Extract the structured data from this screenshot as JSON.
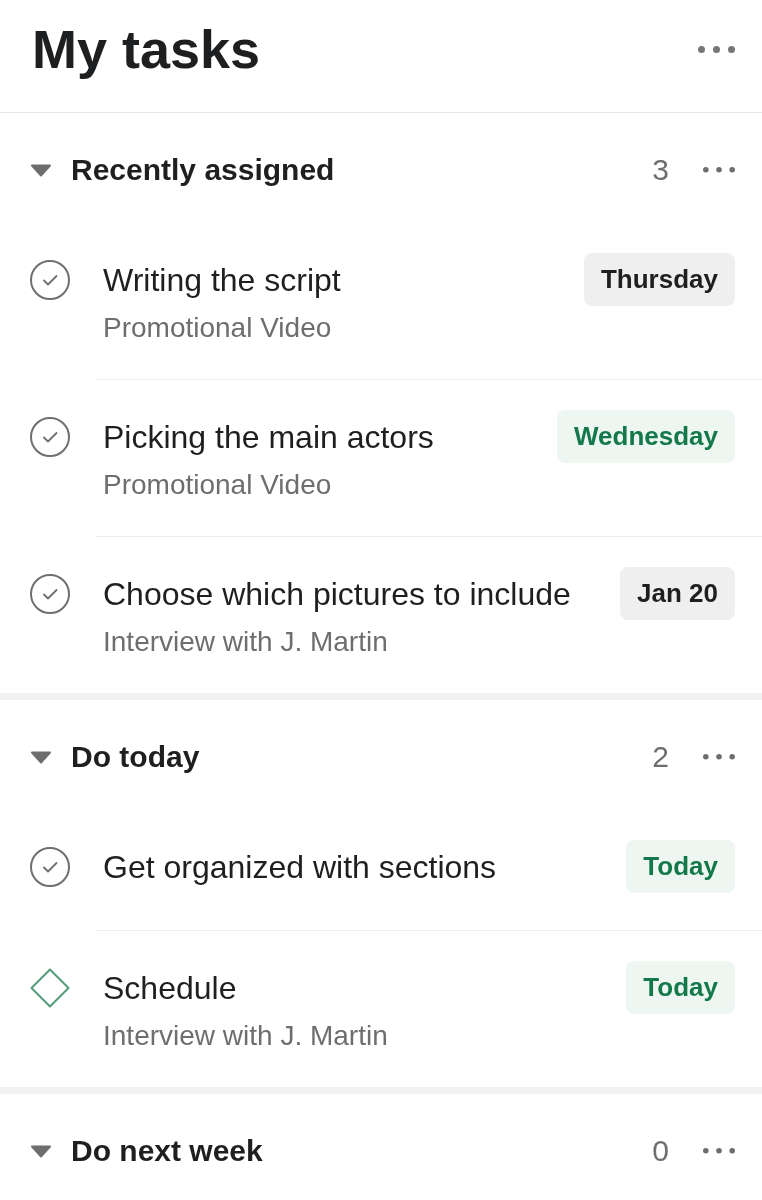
{
  "header": {
    "title": "My tasks"
  },
  "sections": [
    {
      "title": "Recently assigned",
      "expanded": true,
      "count": "3",
      "tasks": [
        {
          "kind": "task",
          "title": "Writing the script",
          "project": "Promotional Video",
          "due": {
            "text": "Thursday",
            "color": "#1e1f21"
          }
        },
        {
          "kind": "task",
          "title": "Picking the main actors",
          "project": "Promotional Video",
          "due": {
            "text": "Wednesday",
            "color": "#14794a"
          }
        },
        {
          "kind": "task",
          "title": "Choose which pictures to include",
          "project": "Interview with J. Martin",
          "due": {
            "text": "Jan 20",
            "color": "#1e1f21"
          }
        }
      ]
    },
    {
      "title": "Do today",
      "expanded": true,
      "count": "2",
      "tasks": [
        {
          "kind": "task",
          "title": "Get organized with sections",
          "due": {
            "text": "Today",
            "color": "#14794a"
          }
        },
        {
          "kind": "milestone",
          "title": "Schedule",
          "project": "Interview with J. Martin",
          "due": {
            "text": "Today",
            "color": "#14794a"
          }
        }
      ]
    },
    {
      "title": "Do next week",
      "expanded": true,
      "count": "0"
    }
  ]
}
